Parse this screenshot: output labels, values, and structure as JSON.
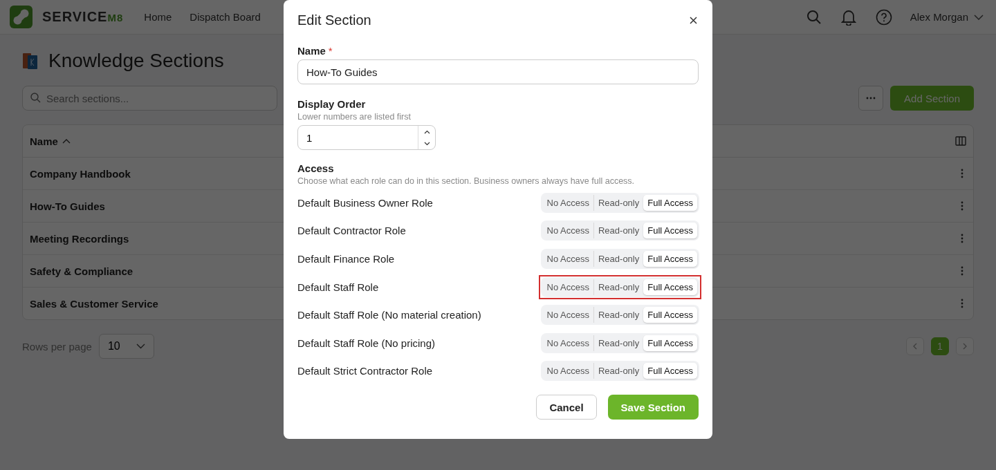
{
  "nav": {
    "logo_text": "SERVICE",
    "logo_suffix": "M8",
    "items": [
      "Home",
      "Dispatch Board"
    ],
    "user": "Alex Morgan"
  },
  "page": {
    "title": "Knowledge Sections",
    "search": {
      "placeholder": "Search sections..."
    },
    "add_button": "Add Section"
  },
  "table": {
    "columns": [
      "Name"
    ],
    "rows": [
      "Company Handbook",
      "How-To Guides",
      "Meeting Recordings",
      "Safety & Compliance",
      "Sales & Customer Service"
    ]
  },
  "pagination": {
    "rows_label": "Rows per page",
    "rows_value": "10",
    "pages": [
      {
        "label": "1",
        "selected": true
      }
    ]
  },
  "dialog": {
    "title": "Edit Section",
    "name": {
      "label": "Name",
      "required_mark": "*",
      "value": "How-To Guides"
    },
    "order": {
      "label": "Display Order",
      "hint": "Lower numbers are listed first",
      "value": "1"
    },
    "access": {
      "label": "Access",
      "hint": "Choose what each role can do in this section. Business owners always have full access.",
      "roles": [
        {
          "name": "Default Business Owner Role",
          "highlighted": false,
          "options": [
            {
              "label": "No Access",
              "selected": false
            },
            {
              "label": "Read-only",
              "selected": false
            },
            {
              "label": "Full Access",
              "selected": true
            }
          ]
        },
        {
          "name": "Default Contractor Role",
          "highlighted": false,
          "options": [
            {
              "label": "No Access",
              "selected": false
            },
            {
              "label": "Read-only",
              "selected": false
            },
            {
              "label": "Full Access",
              "selected": true
            }
          ]
        },
        {
          "name": "Default Finance Role",
          "highlighted": false,
          "options": [
            {
              "label": "No Access",
              "selected": false
            },
            {
              "label": "Read-only",
              "selected": false
            },
            {
              "label": "Full Access",
              "selected": true
            }
          ]
        },
        {
          "name": "Default Staff Role",
          "highlighted": true,
          "options": [
            {
              "label": "No Access",
              "selected": false
            },
            {
              "label": "Read-only",
              "selected": false
            },
            {
              "label": "Full Access",
              "selected": true
            }
          ]
        },
        {
          "name": "Default Staff Role (No material creation)",
          "highlighted": false,
          "options": [
            {
              "label": "No Access",
              "selected": false
            },
            {
              "label": "Read-only",
              "selected": false
            },
            {
              "label": "Full Access",
              "selected": true
            }
          ]
        },
        {
          "name": "Default Staff Role (No pricing)",
          "highlighted": false,
          "options": [
            {
              "label": "No Access",
              "selected": false
            },
            {
              "label": "Read-only",
              "selected": false
            },
            {
              "label": "Full Access",
              "selected": true
            }
          ]
        },
        {
          "name": "Default Strict Contractor Role",
          "highlighted": false,
          "options": [
            {
              "label": "No Access",
              "selected": false
            },
            {
              "label": "Read-only",
              "selected": false
            },
            {
              "label": "Full Access",
              "selected": true
            }
          ]
        }
      ]
    },
    "buttons": {
      "cancel": "Cancel",
      "save": "Save Section"
    }
  }
}
